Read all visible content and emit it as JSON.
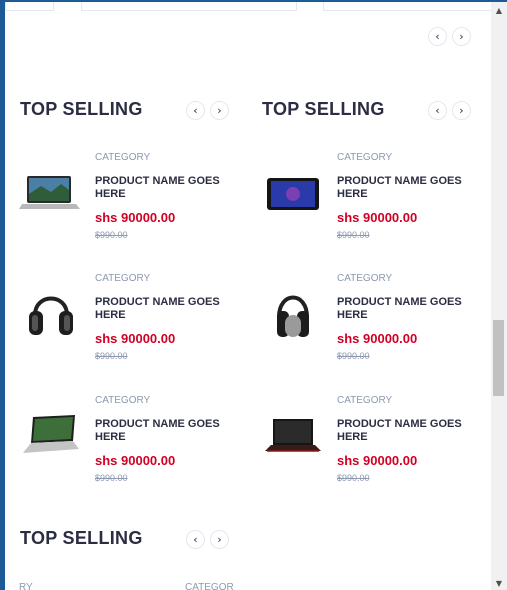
{
  "sections": [
    {
      "title": "TOP SELLING",
      "products": [
        {
          "category": "CATEGORY",
          "name": "PRODUCT NAME GOES HERE",
          "price": "shs 90000.00",
          "old_price": "$990.00",
          "image": "laptop-icon"
        },
        {
          "category": "CATEGORY",
          "name": "PRODUCT NAME GOES HERE",
          "price": "shs 90000.00",
          "old_price": "$990.00",
          "image": "headphones-icon"
        },
        {
          "category": "CATEGORY",
          "name": "PRODUCT NAME GOES HERE",
          "price": "shs 90000.00",
          "old_price": "$990.00",
          "image": "laptop-icon"
        }
      ]
    },
    {
      "title": "TOP SELLING",
      "products": [
        {
          "category": "CATEGORY",
          "name": "PRODUCT NAME GOES HERE",
          "price": "shs 90000.00",
          "old_price": "$990.00",
          "image": "tablet-icon"
        },
        {
          "category": "CATEGORY",
          "name": "PRODUCT NAME GOES HERE",
          "price": "shs 90000.00",
          "old_price": "$990.00",
          "image": "headphones-icon"
        },
        {
          "category": "CATEGORY",
          "name": "PRODUCT NAME GOES HERE",
          "price": "shs 90000.00",
          "old_price": "$990.00",
          "image": "laptop-icon"
        }
      ]
    },
    {
      "title": "TOP SELLING",
      "partial_left": "RY",
      "partial_right": "CATEGOR"
    }
  ],
  "nav": {
    "prev": "‹",
    "next": "›"
  },
  "colors": {
    "accent": "#d10024",
    "title": "#2b2d42",
    "muted": "#8d99ae",
    "frame": "#1d5a98"
  }
}
